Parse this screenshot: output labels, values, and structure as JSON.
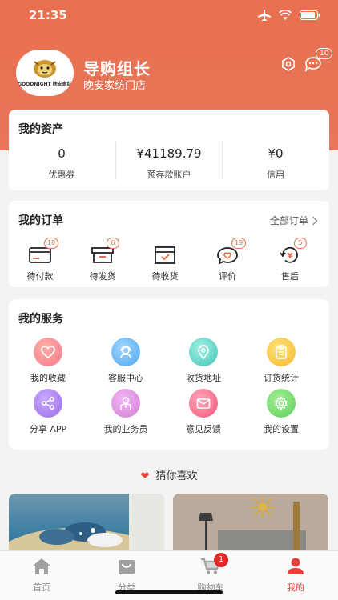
{
  "status_bar": {
    "time": "21:35"
  },
  "profile": {
    "name": "导购组长",
    "store": "晚安家纺门店",
    "logo_text": "GOODNIGHT 晚安家纺",
    "message_count": "10"
  },
  "assets": {
    "title": "我的资产",
    "items": [
      {
        "value": "0",
        "label": "优惠券"
      },
      {
        "value": "¥41189.79",
        "label": "预存款账户"
      },
      {
        "value": "¥0",
        "label": "信用"
      }
    ]
  },
  "orders": {
    "title": "我的订单",
    "all_label": "全部订单",
    "items": [
      {
        "label": "待付款",
        "badge": "10",
        "icon": "wallet-icon"
      },
      {
        "label": "待发货",
        "badge": "6",
        "icon": "box-icon"
      },
      {
        "label": "待收货",
        "badge": "",
        "icon": "received-box-icon"
      },
      {
        "label": "评价",
        "badge": "19",
        "icon": "review-icon"
      },
      {
        "label": "售后",
        "badge": "5",
        "icon": "refund-icon"
      }
    ]
  },
  "services": {
    "title": "我的服务",
    "items": [
      {
        "label": "我的收藏",
        "icon": "heart-icon",
        "color": "#f5788a"
      },
      {
        "label": "客服中心",
        "icon": "support-agent-icon",
        "color": "#4fa8ef"
      },
      {
        "label": "收货地址",
        "icon": "location-icon",
        "color": "#42c5b8"
      },
      {
        "label": "订货统计",
        "icon": "clipboard-icon",
        "color": "#f5b82c"
      },
      {
        "label": "分享 APP",
        "icon": "share-icon",
        "color": "#9a6ee6"
      },
      {
        "label": "我的业务员",
        "icon": "salesperson-icon",
        "color": "#d37fd6"
      },
      {
        "label": "意见反馈",
        "icon": "feedback-mail-icon",
        "color": "#f2577a"
      },
      {
        "label": "我的设置",
        "icon": "gear-icon",
        "color": "#5ccf5a"
      }
    ]
  },
  "guess": {
    "title": "猜你喜欢"
  },
  "tabbar": {
    "items": [
      {
        "label": "首页",
        "icon": "home-icon"
      },
      {
        "label": "分类",
        "icon": "bag-icon"
      },
      {
        "label": "购物车",
        "icon": "cart-icon",
        "badge": "1"
      },
      {
        "label": "我的",
        "icon": "user-icon",
        "active": true
      }
    ]
  },
  "colors": {
    "accent": "#e8704f",
    "active_tab": "#e8403a",
    "badge_red": "#e32a2a"
  }
}
